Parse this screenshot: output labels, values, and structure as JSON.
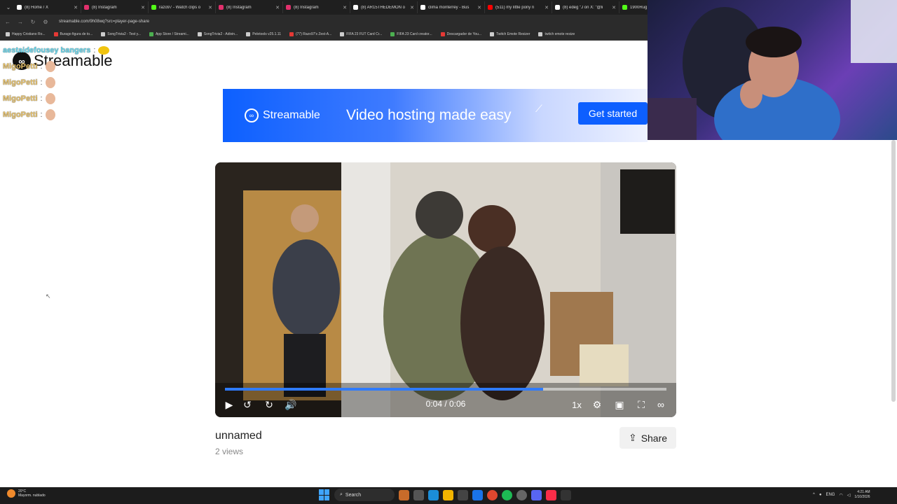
{
  "browser": {
    "tabs": [
      {
        "label": "(8) Home / X",
        "color": "#ffffff"
      },
      {
        "label": "(8) Instagram",
        "color": "#e1306c"
      },
      {
        "label": "razo97 - Watch clips o",
        "color": "#53fc18"
      },
      {
        "label": "(8) Instagram",
        "color": "#e1306c"
      },
      {
        "label": "(8) Instagram",
        "color": "#e1306c"
      },
      {
        "label": "(8) AR15THEDEMON o",
        "color": "#ffffff"
      },
      {
        "label": "clima monterrey - Bus",
        "color": "#ffffff"
      },
      {
        "label": "(511) my little pony n",
        "color": "#ff0000"
      },
      {
        "label": "(8) edeg \"J on X: \"@li",
        "color": "#ffffff"
      },
      {
        "label": "1900Rug",
        "color": "#53fc18"
      }
    ],
    "url": "streamable.com/9h08wq?src=player-page-share",
    "bookmarks": [
      {
        "label": "Happy Cristiano Ro...",
        "color": "#cccccc"
      },
      {
        "label": "Burago figura de to...",
        "color": "#e53935"
      },
      {
        "label": "SongTrivia2 - Test y...",
        "color": "#cccccc"
      },
      {
        "label": "App Store / Streami...",
        "color": "#4caf50"
      },
      {
        "label": "SongTrivia2 - Adivin...",
        "color": "#cccccc"
      },
      {
        "label": "Peletools v25.1.11",
        "color": "#cccccc"
      },
      {
        "label": "(77) Razo97's Zest-A...",
        "color": "#e53935"
      },
      {
        "label": "FIFA 23 FUT Card Cr...",
        "color": "#cccccc"
      },
      {
        "label": "FIFA 23 Card creator...",
        "color": "#4caf50"
      },
      {
        "label": "Descargador de You...",
        "color": "#e53935"
      },
      {
        "label": "Twitch Emote Resizer",
        "color": "#cccccc"
      },
      {
        "label": "twitch emote resize",
        "color": "#cccccc"
      }
    ]
  },
  "page": {
    "logo": "Streamable",
    "banner": {
      "brand": "Streamable",
      "tagline": "Video hosting made easy",
      "button": "Get started",
      "bg_color": "#0d60ff"
    },
    "player": {
      "time": "0:04 / 0:06",
      "progress": 0.72,
      "speed": "1x",
      "accent": "#2f7bff"
    },
    "video": {
      "title": "unnamed",
      "views": "2 views"
    },
    "share_label": "Share"
  },
  "chat": [
    {
      "user": "aestaidefousey bangers",
      "emote": "cool"
    },
    {
      "user": "MigoPetti",
      "emote": "face"
    },
    {
      "user": "MigoPetti",
      "emote": "face"
    },
    {
      "user": "MigoPetti",
      "emote": "face"
    },
    {
      "user": "MigoPetti",
      "emote": "face"
    }
  ],
  "taskbar": {
    "weather_temp": "20°C",
    "weather_desc": "Mayorm. nublado",
    "search": "Search",
    "lang": "ENG",
    "time": "4:21 AM",
    "date": "1/10/2026"
  }
}
